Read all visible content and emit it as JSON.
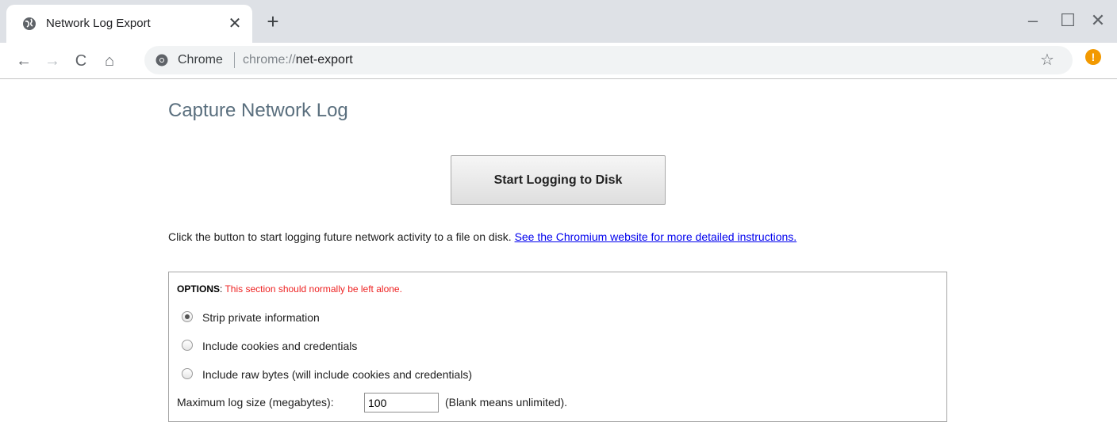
{
  "browser": {
    "tab": {
      "title": "Network Log Export",
      "close_glyph": "✕",
      "favicon": "globe-icon"
    },
    "new_tab_glyph": "+",
    "window_controls": {
      "minimize": "–",
      "maximize": "☐",
      "close": "✕"
    },
    "toolbar": {
      "back": "←",
      "forward": "→",
      "reload": "C",
      "home": "⌂"
    },
    "omnibox": {
      "site_label": "Chrome",
      "url_scheme": "chrome://",
      "url_host": "net-export",
      "star_glyph": "☆",
      "alert_glyph": "!"
    }
  },
  "page": {
    "title": "Capture Network Log",
    "start_button": "Start Logging to Disk",
    "instructions_text": "Click the button to start logging future network activity to a file on disk. ",
    "instructions_link": "See the Chromium website for more detailed instructions.",
    "options": {
      "heading": "OPTIONS",
      "colon": ": ",
      "warning": "This section should normally be left alone.",
      "radios": [
        {
          "label": "Strip private information",
          "checked": true
        },
        {
          "label": "Include cookies and credentials",
          "checked": false
        },
        {
          "label": "Include raw bytes (will include cookies and credentials)",
          "checked": false
        }
      ],
      "max_size_label": "Maximum log size (megabytes):",
      "max_size_value": "100",
      "max_size_hint": "(Blank means unlimited)."
    }
  },
  "colors": {
    "title": "#5a6f7e",
    "warning": "#ee2222",
    "link": "#0000ee",
    "alert": "#f29900"
  }
}
